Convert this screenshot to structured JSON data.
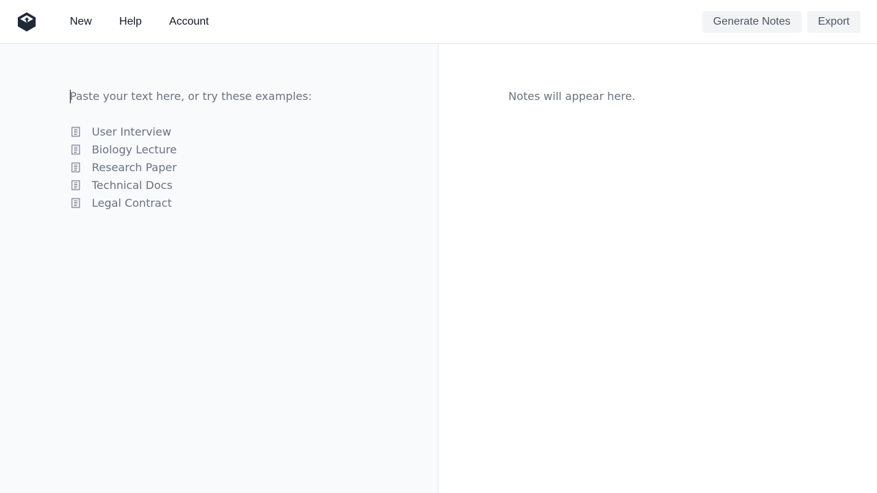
{
  "header": {
    "logo_icon": "cube-arrow-logo-icon",
    "menu": [
      {
        "label": "New"
      },
      {
        "label": "Help"
      },
      {
        "label": "Account"
      }
    ],
    "actions": {
      "generate_label": "Generate Notes",
      "export_label": "Export"
    }
  },
  "editor": {
    "prompt": "Paste your text here, or try these examples:",
    "examples": [
      {
        "label": "User Interview",
        "icon": "document-icon"
      },
      {
        "label": "Biology Lecture",
        "icon": "document-icon"
      },
      {
        "label": "Research Paper",
        "icon": "document-icon"
      },
      {
        "label": "Technical Docs",
        "icon": "document-icon"
      },
      {
        "label": "Legal Contract",
        "icon": "document-icon"
      }
    ]
  },
  "notes": {
    "placeholder": "Notes will appear here."
  },
  "colors": {
    "logo": "#1f2937",
    "left_pane_background": "#f8fafc",
    "right_pane_background": "#ffffff",
    "divider": "#e5e7eb",
    "button_background": "#f3f4f6",
    "muted_text": "#6b7280"
  }
}
